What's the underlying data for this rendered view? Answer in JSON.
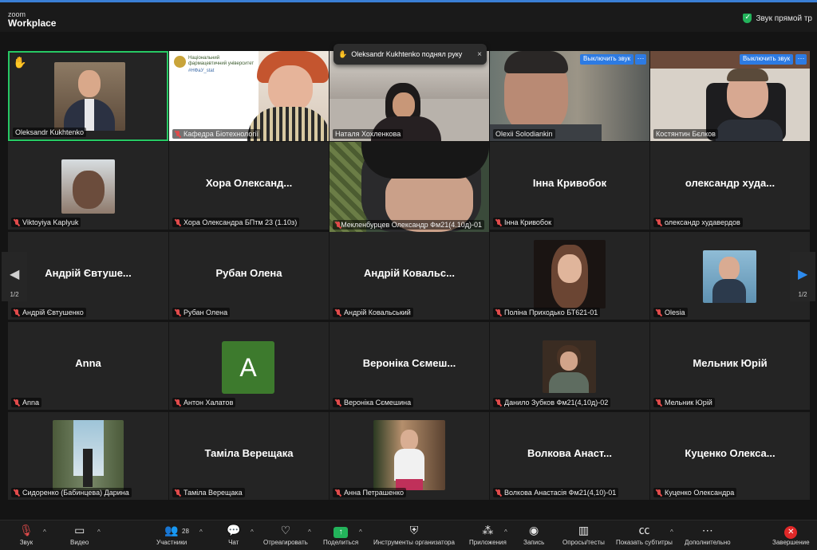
{
  "app": {
    "logo_line1": "zoom",
    "logo_line2": "Workplace",
    "audio_status": "Звук прямой тр"
  },
  "notification": {
    "text": "Oleksandr Kukhtenko поднял руку",
    "close": "×"
  },
  "tile_actions": {
    "mute_label": "Выключить звук",
    "more": "···"
  },
  "slide": {
    "org_name": "Національний фармацевтичний університет",
    "tag": "#НФаУ_stat"
  },
  "tiles": [
    {
      "label": "Oleksandr Kukhtenko",
      "muted": false
    },
    {
      "label": "Кафедра Біотехнології",
      "muted": true
    },
    {
      "label": "Наталя Хохленкова",
      "muted": false
    },
    {
      "label": "Olexii Solodiankin",
      "muted": false
    },
    {
      "label": "Костянтин Бєлков",
      "muted": false
    },
    {
      "label": "Viktoyiya Kaplyuk",
      "muted": true
    },
    {
      "big": "Хора Олександ...",
      "label": "Хора Олександра БПтм 23 (1.10з)",
      "muted": true
    },
    {
      "label": "Мекленбурцев Олександр Фм21(4.10д)-01",
      "muted": true
    },
    {
      "big": "Інна Кривобок",
      "label": "Інна Кривобок",
      "muted": true
    },
    {
      "big": "олександр худа...",
      "label": "олександр худавердов",
      "muted": true
    },
    {
      "big": "Андрій Євтуше...",
      "label": "Андрій Євтушенко",
      "muted": true
    },
    {
      "big": "Рубан Олена",
      "label": "Рубан Олена",
      "muted": true
    },
    {
      "big": "Андрій Ковальс...",
      "label": "Андрій Ковальський",
      "muted": true
    },
    {
      "label": "Поліна Приходько БТ621-01",
      "muted": true
    },
    {
      "label": "Olesia",
      "muted": true
    },
    {
      "big": "Anna",
      "label": "Anna",
      "muted": true
    },
    {
      "letter": "A",
      "label": "Антон Халатов",
      "muted": true
    },
    {
      "big": "Вероніка Сємеш...",
      "label": "Вероніка Сємешина",
      "muted": true
    },
    {
      "label": "Данило Зубков Фм21(4,10д)-02",
      "muted": true
    },
    {
      "big": "Мельник Юрій",
      "label": "Мельник Юрій",
      "muted": true
    },
    {
      "label": "Сидоренко (Бабинцева) Дарина",
      "muted": true
    },
    {
      "big": "Таміла Верещака",
      "label": "Таміла Верещака",
      "muted": true
    },
    {
      "label": "Анна Петрашенко",
      "muted": true
    },
    {
      "big": "Волкова Анаст...",
      "label": "Волкова Анастасія Фм21(4,10)-01",
      "muted": true
    },
    {
      "big": "Куценко Олекса...",
      "label": "Куценко Олександра",
      "muted": true
    }
  ],
  "pager": {
    "left": "1/2",
    "right": "1/2"
  },
  "toolbar": {
    "audio": "Звук",
    "video": "Видео",
    "participants": "Участники",
    "participants_count": "28",
    "chat": "Чат",
    "react": "Отреагировать",
    "share": "Поделиться",
    "host_tools": "Инструменты организатора",
    "apps": "Приложения",
    "record": "Запись",
    "polls": "Опросы/тесты",
    "captions": "Показать субтитры",
    "more": "Дополнительно",
    "end": "Завершение"
  },
  "colors": {
    "accent": "#2d7be3",
    "active_speaker": "#27c964",
    "muted": "#e14b4b",
    "share": "#23b35b",
    "end": "#e02828",
    "avatar_a": "#3d7a2d"
  }
}
